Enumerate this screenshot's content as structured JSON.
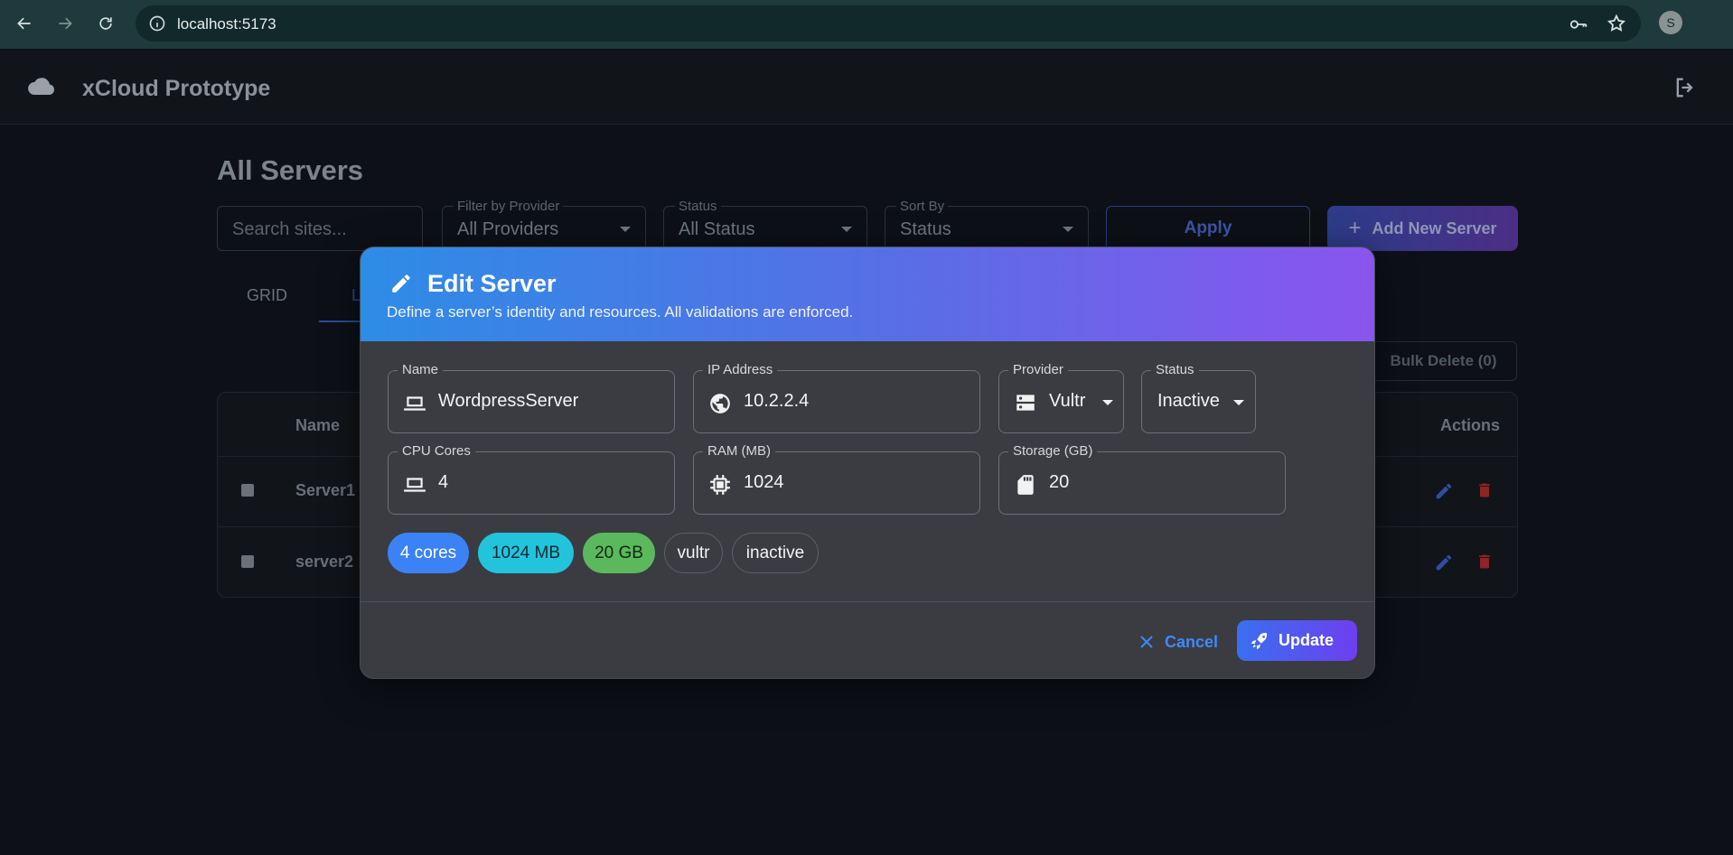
{
  "browser": {
    "url": "localhost:5173",
    "profile_initial": "S"
  },
  "header": {
    "app_title": "xCloud Prototype"
  },
  "page": {
    "title": "All Servers",
    "search_placeholder": "Search sites...",
    "filter_provider": {
      "label": "Filter by Provider",
      "value": "All Providers"
    },
    "filter_status": {
      "label": "Status",
      "value": "All Status"
    },
    "sort_by": {
      "label": "Sort By",
      "value": "Status"
    },
    "apply_label": "Apply",
    "add_label": "Add New Server",
    "tabs": [
      "GRID",
      "L"
    ],
    "bulk_delete_label": "Bulk Delete (0)",
    "table": {
      "col_name": "Name",
      "col_actions": "Actions",
      "rows": [
        {
          "name": "Server1"
        },
        {
          "name": "server2"
        }
      ]
    }
  },
  "modal": {
    "title": "Edit Server",
    "subtitle": "Define a server’s identity and resources. All validations are enforced.",
    "fields": {
      "name": {
        "label": "Name",
        "value": "WordpressServer"
      },
      "ip": {
        "label": "IP Address",
        "value": "10.2.2.4"
      },
      "provider": {
        "label": "Provider",
        "value": "Vultr"
      },
      "status": {
        "label": "Status",
        "value": "Inactive"
      },
      "cpu": {
        "label": "CPU Cores",
        "value": "4"
      },
      "ram": {
        "label": "RAM (MB)",
        "value": "1024"
      },
      "storage": {
        "label": "Storage (GB)",
        "value": "20"
      }
    },
    "chips": [
      {
        "text": "4 cores",
        "color": "#3b82f6"
      },
      {
        "text": "1024 MB",
        "color": "#22c4dc"
      },
      {
        "text": "20 GB",
        "color": "#5cb85c"
      },
      {
        "text": "vultr",
        "color": "#3a3c41"
      },
      {
        "text": "inactive",
        "color": "#3a3c41"
      }
    ],
    "cancel_label": "Cancel",
    "update_label": "Update"
  }
}
